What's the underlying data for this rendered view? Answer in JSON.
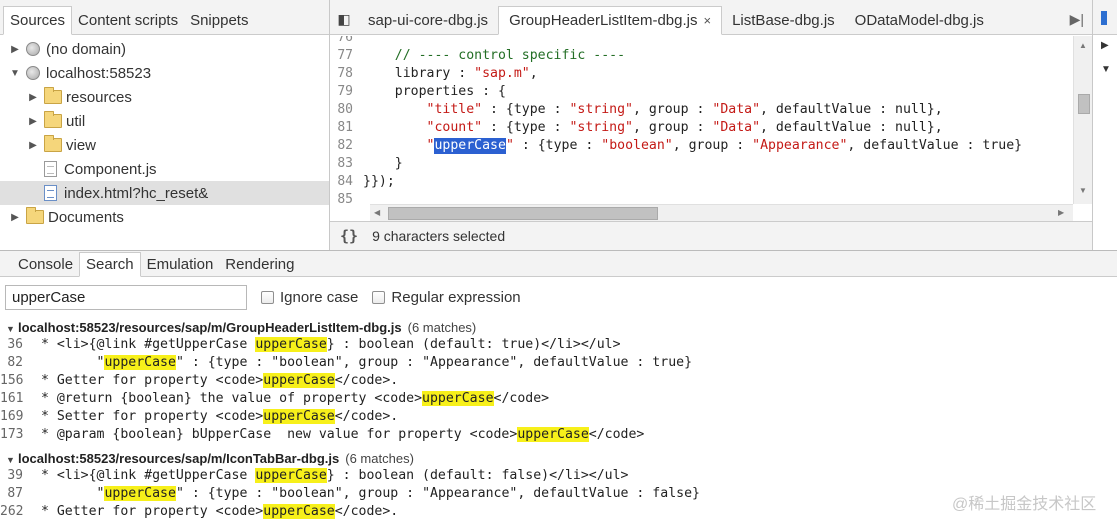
{
  "navigator": {
    "tabs": [
      "Sources",
      "Content scripts",
      "Snippets"
    ],
    "tree": [
      {
        "label": "(no domain)",
        "icon": "globe-icon",
        "expand": "▶"
      },
      {
        "label": "localhost:58523",
        "icon": "globe-icon",
        "expand": "▼"
      },
      {
        "label": "resources",
        "icon": "folder-icon",
        "expand": "▶"
      },
      {
        "label": "util",
        "icon": "folder-icon",
        "expand": "▶"
      },
      {
        "label": "view",
        "icon": "folder-icon",
        "expand": "▶"
      },
      {
        "label": "Component.js",
        "icon": "js-file-icon",
        "expand": ""
      },
      {
        "label": "index.html?hc_reset&",
        "icon": "html-file-icon",
        "expand": "",
        "selected": true
      },
      {
        "label": "Documents",
        "icon": "folder-icon",
        "expand": "▶"
      }
    ]
  },
  "editor": {
    "tabs": [
      {
        "label": "sap-ui-core-dbg.js",
        "active": false
      },
      {
        "label": "GroupHeaderListItem-dbg.js",
        "active": true,
        "close": "×"
      },
      {
        "label": "ListBase-dbg.js",
        "active": false
      },
      {
        "label": "ODataModel-dbg.js",
        "active": false
      }
    ],
    "lines": [
      {
        "n": "76",
        "segs": [
          {
            "t": ""
          }
        ]
      },
      {
        "n": "77",
        "segs": [
          {
            "t": "    "
          },
          {
            "t": "// ---- control specific ----",
            "c": "cm"
          }
        ]
      },
      {
        "n": "78",
        "segs": [
          {
            "t": "    library : "
          },
          {
            "t": "\"sap.m\"",
            "c": "st"
          },
          {
            "t": ","
          }
        ]
      },
      {
        "n": "79",
        "segs": [
          {
            "t": "    properties : {"
          }
        ]
      },
      {
        "n": "80",
        "segs": [
          {
            "t": "        "
          },
          {
            "t": "\"title\"",
            "c": "st"
          },
          {
            "t": " : {type : "
          },
          {
            "t": "\"string\"",
            "c": "st"
          },
          {
            "t": ", group : "
          },
          {
            "t": "\"Data\"",
            "c": "st"
          },
          {
            "t": ", defaultValue : null},"
          }
        ]
      },
      {
        "n": "81",
        "segs": [
          {
            "t": "        "
          },
          {
            "t": "\"count\"",
            "c": "st"
          },
          {
            "t": " : {type : "
          },
          {
            "t": "\"string\"",
            "c": "st"
          },
          {
            "t": ", group : "
          },
          {
            "t": "\"Data\"",
            "c": "st"
          },
          {
            "t": ", defaultValue : null},"
          }
        ]
      },
      {
        "n": "82",
        "segs": [
          {
            "t": "        "
          },
          {
            "t": "\"",
            "c": "st"
          },
          {
            "t": "upperCase",
            "c": "sel-word"
          },
          {
            "t": "\"",
            "c": "st"
          },
          {
            "t": " : {type : "
          },
          {
            "t": "\"boolean\"",
            "c": "st"
          },
          {
            "t": ", group : "
          },
          {
            "t": "\"Appearance\"",
            "c": "st"
          },
          {
            "t": ", defaultValue : true}"
          }
        ]
      },
      {
        "n": "83",
        "segs": [
          {
            "t": "    }"
          }
        ]
      },
      {
        "n": "84",
        "segs": [
          {
            "t": "}});"
          }
        ]
      },
      {
        "n": "85",
        "segs": [
          {
            "t": ""
          }
        ]
      }
    ],
    "status_text": "9 characters selected",
    "pretty_print": "{}"
  },
  "drawer": {
    "tabs": [
      "Console",
      "Search",
      "Emulation",
      "Rendering"
    ],
    "active_tab": "Search",
    "search_value": "upperCase",
    "ignore_case_label": "Ignore case",
    "regex_label": "Regular expression",
    "results": [
      {
        "file": "localhost:58523/resources/sap/m/GroupHeaderListItem-dbg.js",
        "count": "(6 matches)",
        "lines": [
          {
            "n": "36",
            "segs": [
              {
                "t": " * <li>{@link #getUpperCase "
              },
              {
                "t": "upperCase",
                "h": true
              },
              {
                "t": "} : boolean (default: true)</li></ul>"
              }
            ]
          },
          {
            "n": "82",
            "segs": [
              {
                "t": "        \""
              },
              {
                "t": "upperCase",
                "h": true
              },
              {
                "t": "\" : {type : \"boolean\", group : \"Appearance\", defaultValue : true}"
              }
            ]
          },
          {
            "n": "156",
            "segs": [
              {
                "t": " * Getter for property <code>"
              },
              {
                "t": "upperCase",
                "h": true
              },
              {
                "t": "</code>."
              }
            ]
          },
          {
            "n": "161",
            "segs": [
              {
                "t": " * @return {boolean} the value of property <code>"
              },
              {
                "t": "upperCase",
                "h": true
              },
              {
                "t": "</code>"
              }
            ]
          },
          {
            "n": "169",
            "segs": [
              {
                "t": " * Setter for property <code>"
              },
              {
                "t": "upperCase",
                "h": true
              },
              {
                "t": "</code>."
              }
            ]
          },
          {
            "n": "173",
            "segs": [
              {
                "t": " * @param {boolean} bUpperCase  new value for property <code>"
              },
              {
                "t": "upperCase",
                "h": true
              },
              {
                "t": "</code>"
              }
            ]
          }
        ]
      },
      {
        "file": "localhost:58523/resources/sap/m/IconTabBar-dbg.js",
        "count": "(6 matches)",
        "lines": [
          {
            "n": "39",
            "segs": [
              {
                "t": " * <li>{@link #getUpperCase "
              },
              {
                "t": "upperCase",
                "h": true
              },
              {
                "t": "} : boolean (default: false)</li></ul>"
              }
            ]
          },
          {
            "n": "87",
            "segs": [
              {
                "t": "        \""
              },
              {
                "t": "upperCase",
                "h": true
              },
              {
                "t": "\" : {type : \"boolean\", group : \"Appearance\", defaultValue : false}"
              }
            ]
          },
          {
            "n": "262",
            "segs": [
              {
                "t": " * Getter for property <code>"
              },
              {
                "t": "upperCase",
                "h": true
              },
              {
                "t": "</code>."
              }
            ]
          }
        ]
      }
    ]
  },
  "watermark": "@稀土掘金技术社区",
  "colors": {
    "highlight": "#f7f01a",
    "selection": "#2b60d1",
    "string": "#c41a16",
    "comment": "#236e25"
  }
}
